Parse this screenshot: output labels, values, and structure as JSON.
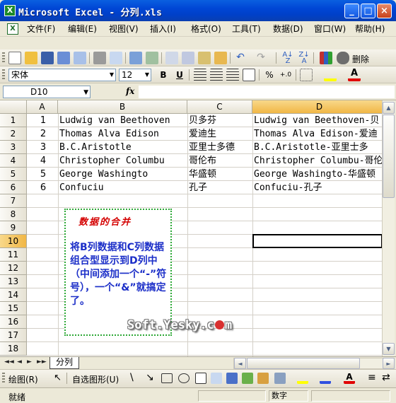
{
  "window": {
    "title": "Microsoft Excel - 分列.xls",
    "icon_label": "X",
    "doc_icon_label": "X"
  },
  "menu": {
    "items": [
      "文件(F)",
      "编辑(E)",
      "视图(V)",
      "插入(I)",
      "格式(O)",
      "工具(T)",
      "数据(D)",
      "窗口(W)",
      "帮助(H)"
    ],
    "right_controls": "- ♢ ×"
  },
  "toolbar": {
    "delete_label": "删除"
  },
  "format_toolbar": {
    "font_name": "宋体",
    "font_size": "12",
    "bold": "B",
    "underline": "U",
    "percent": "%"
  },
  "formula_bar": {
    "name_box": "D10",
    "fx": "fx",
    "content": ""
  },
  "grid": {
    "columns": [
      "A",
      "B",
      "C",
      "D"
    ],
    "rows": [
      "1",
      "2",
      "3",
      "4",
      "5",
      "6",
      "7",
      "8",
      "9",
      "10",
      "11",
      "12",
      "13",
      "14",
      "15",
      "16",
      "17",
      "18"
    ],
    "data": [
      {
        "a": "1",
        "b": "Ludwig van Beethoven",
        "c": "贝多芬",
        "d": "Ludwig van Beethoven-贝"
      },
      {
        "a": "2",
        "b": "Thomas Alva Edison",
        "c": "爱迪生",
        "d": "Thomas Alva Edison-爱迪"
      },
      {
        "a": "3",
        "b": "B.C.Aristotle",
        "c": "亚里士多德",
        "d": "B.C.Aristotle-亚里士多"
      },
      {
        "a": "4",
        "b": "Christopher Columbu",
        "c": "哥伦布",
        "d": "Christopher Columbu-哥伦"
      },
      {
        "a": "5",
        "b": "George Washingto",
        "c": "华盛顿",
        "d": "George Washingto-华盛顿"
      },
      {
        "a": "6",
        "b": "Confuciu",
        "c": "孔子",
        "d": "Confuciu-孔子"
      }
    ],
    "selected_cell": "D10"
  },
  "note": {
    "title": "数据的合并",
    "body": "将B列数据和C列数据组合型显示到D列中（中间添加一个“-”符号），一个“&”就搞定了。"
  },
  "watermark": {
    "prefix": "Soft.Yesky.c",
    "suffix": "m"
  },
  "sheet_tabs": {
    "nav": [
      "◄◄",
      "◄",
      "►",
      "►►"
    ],
    "active": "分列"
  },
  "draw_toolbar": {
    "draw_label": "绘图(R)",
    "autoshape_label": "自选图形(U)"
  },
  "status_bar": {
    "ready": "就绪",
    "num": "数字"
  },
  "colors": {
    "title_blue": "#0046d5",
    "header_highlight": "#f1b746",
    "note_border": "#2ca836",
    "note_title": "#d40000",
    "note_text": "#1c2fc8"
  }
}
